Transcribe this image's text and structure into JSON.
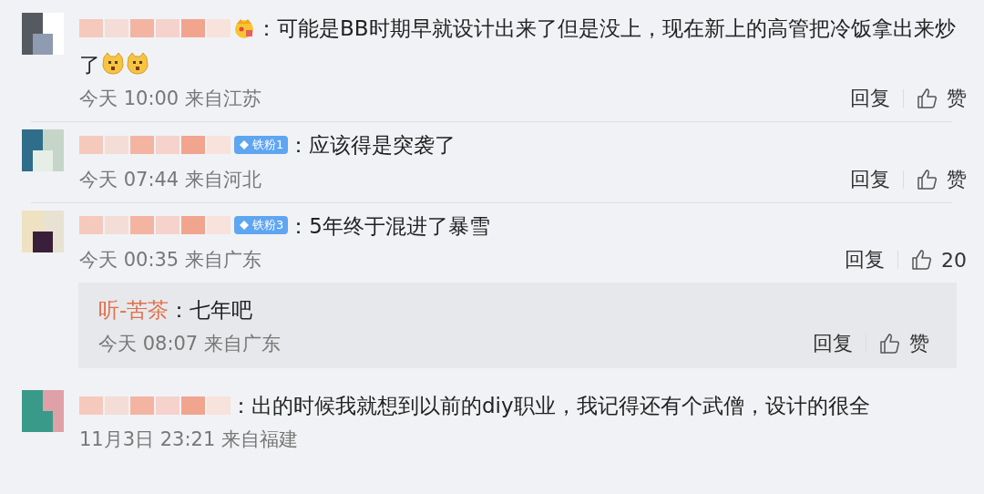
{
  "comments": [
    {
      "badge": {
        "kind": "crown"
      },
      "text": [
        "：可能是BB时期早就设计出来了但是没上，现在新上的高管把冷饭拿出来炒",
        "了"
      ],
      "emojis": [
        {
          "kind": "dog"
        },
        {
          "kind": "dog"
        }
      ],
      "meta": "今天 10:00 来自江苏",
      "reply_label": "回复",
      "like_label": "赞"
    },
    {
      "badge": {
        "kind": "fan",
        "label": "铁粉1"
      },
      "text": "：应该得是突袭了",
      "meta": "今天 07:44 来自河北",
      "reply_label": "回复",
      "like_label": "赞"
    },
    {
      "badge": {
        "kind": "fan",
        "label": "铁粉3"
      },
      "text": "：5年终于混进了暴雪",
      "meta": "今天 00:35 来自广东",
      "reply_label": "回复",
      "like_label": "20",
      "replies": [
        {
          "user": "听-苦茶",
          "text": "：七年吧",
          "meta": "今天 08:07 来自广东",
          "reply_label": "回复",
          "like_label": "赞"
        }
      ]
    },
    {
      "text": "：出的时候我就想到以前的diy职业，我记得还有个武僧，设计的很全",
      "meta": "11月3日 23:21 来自福建"
    }
  ]
}
